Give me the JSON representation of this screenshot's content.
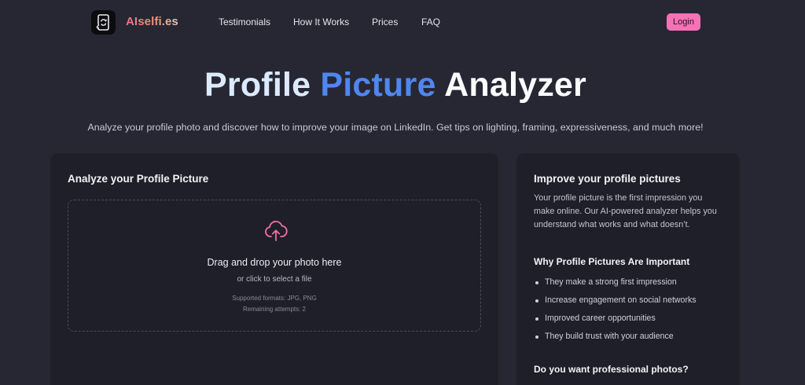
{
  "nav": {
    "brand": "AIselfi.es",
    "links": [
      "Testimonials",
      "How It Works",
      "Prices",
      "FAQ"
    ],
    "login": "Login"
  },
  "hero": {
    "title_part1": "Profile",
    "title_part2": "Picture",
    "title_part3": "Analyzer",
    "subtitle": "Analyze your profile photo and discover how to improve your image on LinkedIn. Get tips on lighting, framing, expressiveness, and much more!"
  },
  "analyze_card": {
    "title": "Analyze your Profile Picture",
    "drop_main": "Drag and drop your photo here",
    "drop_sub": "or click to select a file",
    "formats": "Supported formats: JPG, PNG",
    "attempts": "Remaining attempts: 2"
  },
  "info_card": {
    "title": "Improve your profile pictures",
    "paragraph": "Your profile picture is the first impression you make online. Our AI-powered analyzer helps you understand what works and what doesn’t.",
    "why_title": "Why Profile Pictures Are Important",
    "reasons": [
      "They make a strong first impression",
      "Increase engagement on social networks",
      "Improved career opportunities",
      "They build trust with your audience"
    ],
    "pro_title": "Do you want professional photos?"
  },
  "colors": {
    "background": "#272733",
    "card": "#1f1f29",
    "accent_pink": "#f472b6",
    "title_blue": "#4f86ef"
  },
  "icons": {
    "logo": "refresh-camera-icon",
    "upload": "cloud-upload-icon"
  }
}
